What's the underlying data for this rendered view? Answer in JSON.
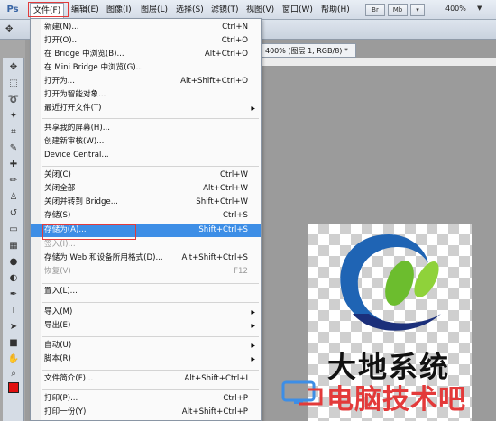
{
  "app": {
    "logo": "Ps"
  },
  "menubar": {
    "items": [
      "文件(F)",
      "编辑(E)",
      "图像(I)",
      "图层(L)",
      "选择(S)",
      "滤镜(T)",
      "视图(V)",
      "窗口(W)",
      "帮助(H)"
    ],
    "toolbar_icons": [
      "Br",
      "Mb"
    ],
    "zoom": "400%"
  },
  "document": {
    "tab_title": "400% (图层 1, RGB/8) *"
  },
  "canvas": {
    "logo_text": "大地系统"
  },
  "watermark": {
    "text": "电脑技术吧"
  },
  "file_menu": {
    "items": [
      {
        "label": "新建(N)...",
        "shortcut": "Ctrl+N"
      },
      {
        "label": "打开(O)...",
        "shortcut": "Ctrl+O"
      },
      {
        "label": "在 Bridge 中浏览(B)...",
        "shortcut": "Alt+Ctrl+O"
      },
      {
        "label": "在 Mini Bridge 中浏览(G)...",
        "shortcut": ""
      },
      {
        "label": "打开为...",
        "shortcut": "Alt+Shift+Ctrl+O"
      },
      {
        "label": "打开为智能对象...",
        "shortcut": ""
      },
      {
        "label": "最近打开文件(T)",
        "shortcut": "",
        "submenu": true
      },
      {
        "label": "共享我的屏幕(H)...",
        "shortcut": ""
      },
      {
        "label": "创建新审核(W)...",
        "shortcut": ""
      },
      {
        "label": "Device Central...",
        "shortcut": ""
      },
      {
        "label": "关闭(C)",
        "shortcut": "Ctrl+W"
      },
      {
        "label": "关闭全部",
        "shortcut": "Alt+Ctrl+W"
      },
      {
        "label": "关闭并转到 Bridge...",
        "shortcut": "Shift+Ctrl+W"
      },
      {
        "label": "存储(S)",
        "shortcut": "Ctrl+S"
      },
      {
        "label": "存储为(A)...",
        "shortcut": "Shift+Ctrl+S",
        "highlighted": true
      },
      {
        "label": "签入(I)...",
        "shortcut": "",
        "disabled": true
      },
      {
        "label": "存储为 Web 和设备所用格式(D)...",
        "shortcut": "Alt+Shift+Ctrl+S"
      },
      {
        "label": "恢复(V)",
        "shortcut": "F12",
        "disabled": true
      },
      {
        "label": "置入(L)...",
        "shortcut": ""
      },
      {
        "label": "导入(M)",
        "shortcut": "",
        "submenu": true
      },
      {
        "label": "导出(E)",
        "shortcut": "",
        "submenu": true
      },
      {
        "label": "自动(U)",
        "shortcut": "",
        "submenu": true
      },
      {
        "label": "脚本(R)",
        "shortcut": "",
        "submenu": true
      },
      {
        "label": "文件简介(F)...",
        "shortcut": "Alt+Shift+Ctrl+I"
      },
      {
        "label": "打印(P)...",
        "shortcut": "Ctrl+P"
      },
      {
        "label": "打印一份(Y)",
        "shortcut": "Alt+Shift+Ctrl+P"
      }
    ]
  },
  "colors": {
    "accent_red": "#e23b3b",
    "highlight_blue": "#3d8ee6"
  }
}
